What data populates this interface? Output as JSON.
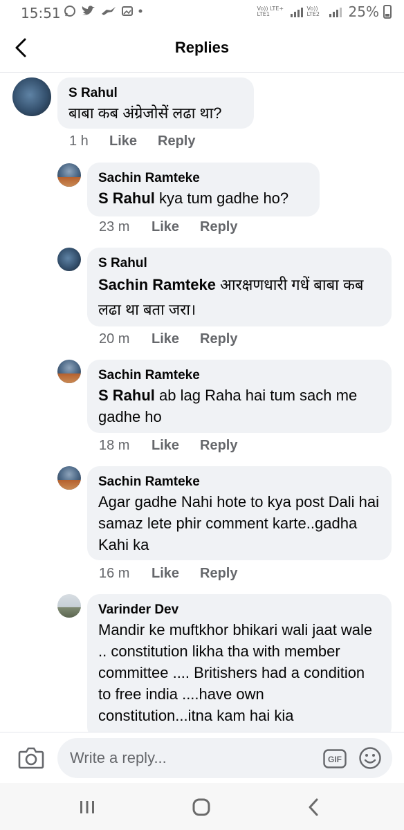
{
  "status_bar": {
    "time": "15:51",
    "left_icons": [
      "whatsapp-icon",
      "twitter-icon",
      "bird-icon",
      "gallery-icon",
      "dot-icon"
    ],
    "network_label_1": "Vo)) LTE+ LTE1",
    "network_label_2": "Vo)) LTE2",
    "battery": "25%"
  },
  "header": {
    "title": "Replies"
  },
  "comments": [
    {
      "author": "S Rahul",
      "mention": "",
      "text": "बाबा कब अंग्रेजोसें लढा था?",
      "time": "1 h",
      "like": "Like",
      "reply": "Reply"
    },
    {
      "author": "Sachin Ramteke",
      "mention": "S Rahul",
      "text": " kya tum gadhe ho?",
      "time": "23 m",
      "like": "Like",
      "reply": "Reply"
    },
    {
      "author": "S Rahul",
      "mention": "Sachin Ramteke",
      "text": " आरक्षणधारी गधें बाबा कब लढा था बता जरा।",
      "time": "20 m",
      "like": "Like",
      "reply": "Reply"
    },
    {
      "author": "Sachin Ramteke",
      "mention": "S Rahul",
      "text": " ab lag Raha hai tum sach me gadhe ho",
      "time": "18 m",
      "like": "Like",
      "reply": "Reply"
    },
    {
      "author": "Sachin Ramteke",
      "mention": "",
      "text": "Agar gadhe Nahi hote to kya post Dali hai samaz lete phir comment karte..gadha Kahi ka",
      "time": "16 m",
      "like": "Like",
      "reply": "Reply"
    },
    {
      "author": "Varinder Dev",
      "mention": "",
      "text": "Mandir ke muftkhor bhikari wali jaat wale .. constitution likha tha with member committee .... Britishers had a condition to free india ....have own constitution...itna kam hai kia",
      "time": "",
      "like": "",
      "reply": ""
    }
  ],
  "composer": {
    "placeholder": "Write a reply...",
    "gif_label": "GIF"
  },
  "colors": {
    "bubble": "#f0f2f5",
    "meta_text": "#65676b",
    "text": "#050505"
  }
}
